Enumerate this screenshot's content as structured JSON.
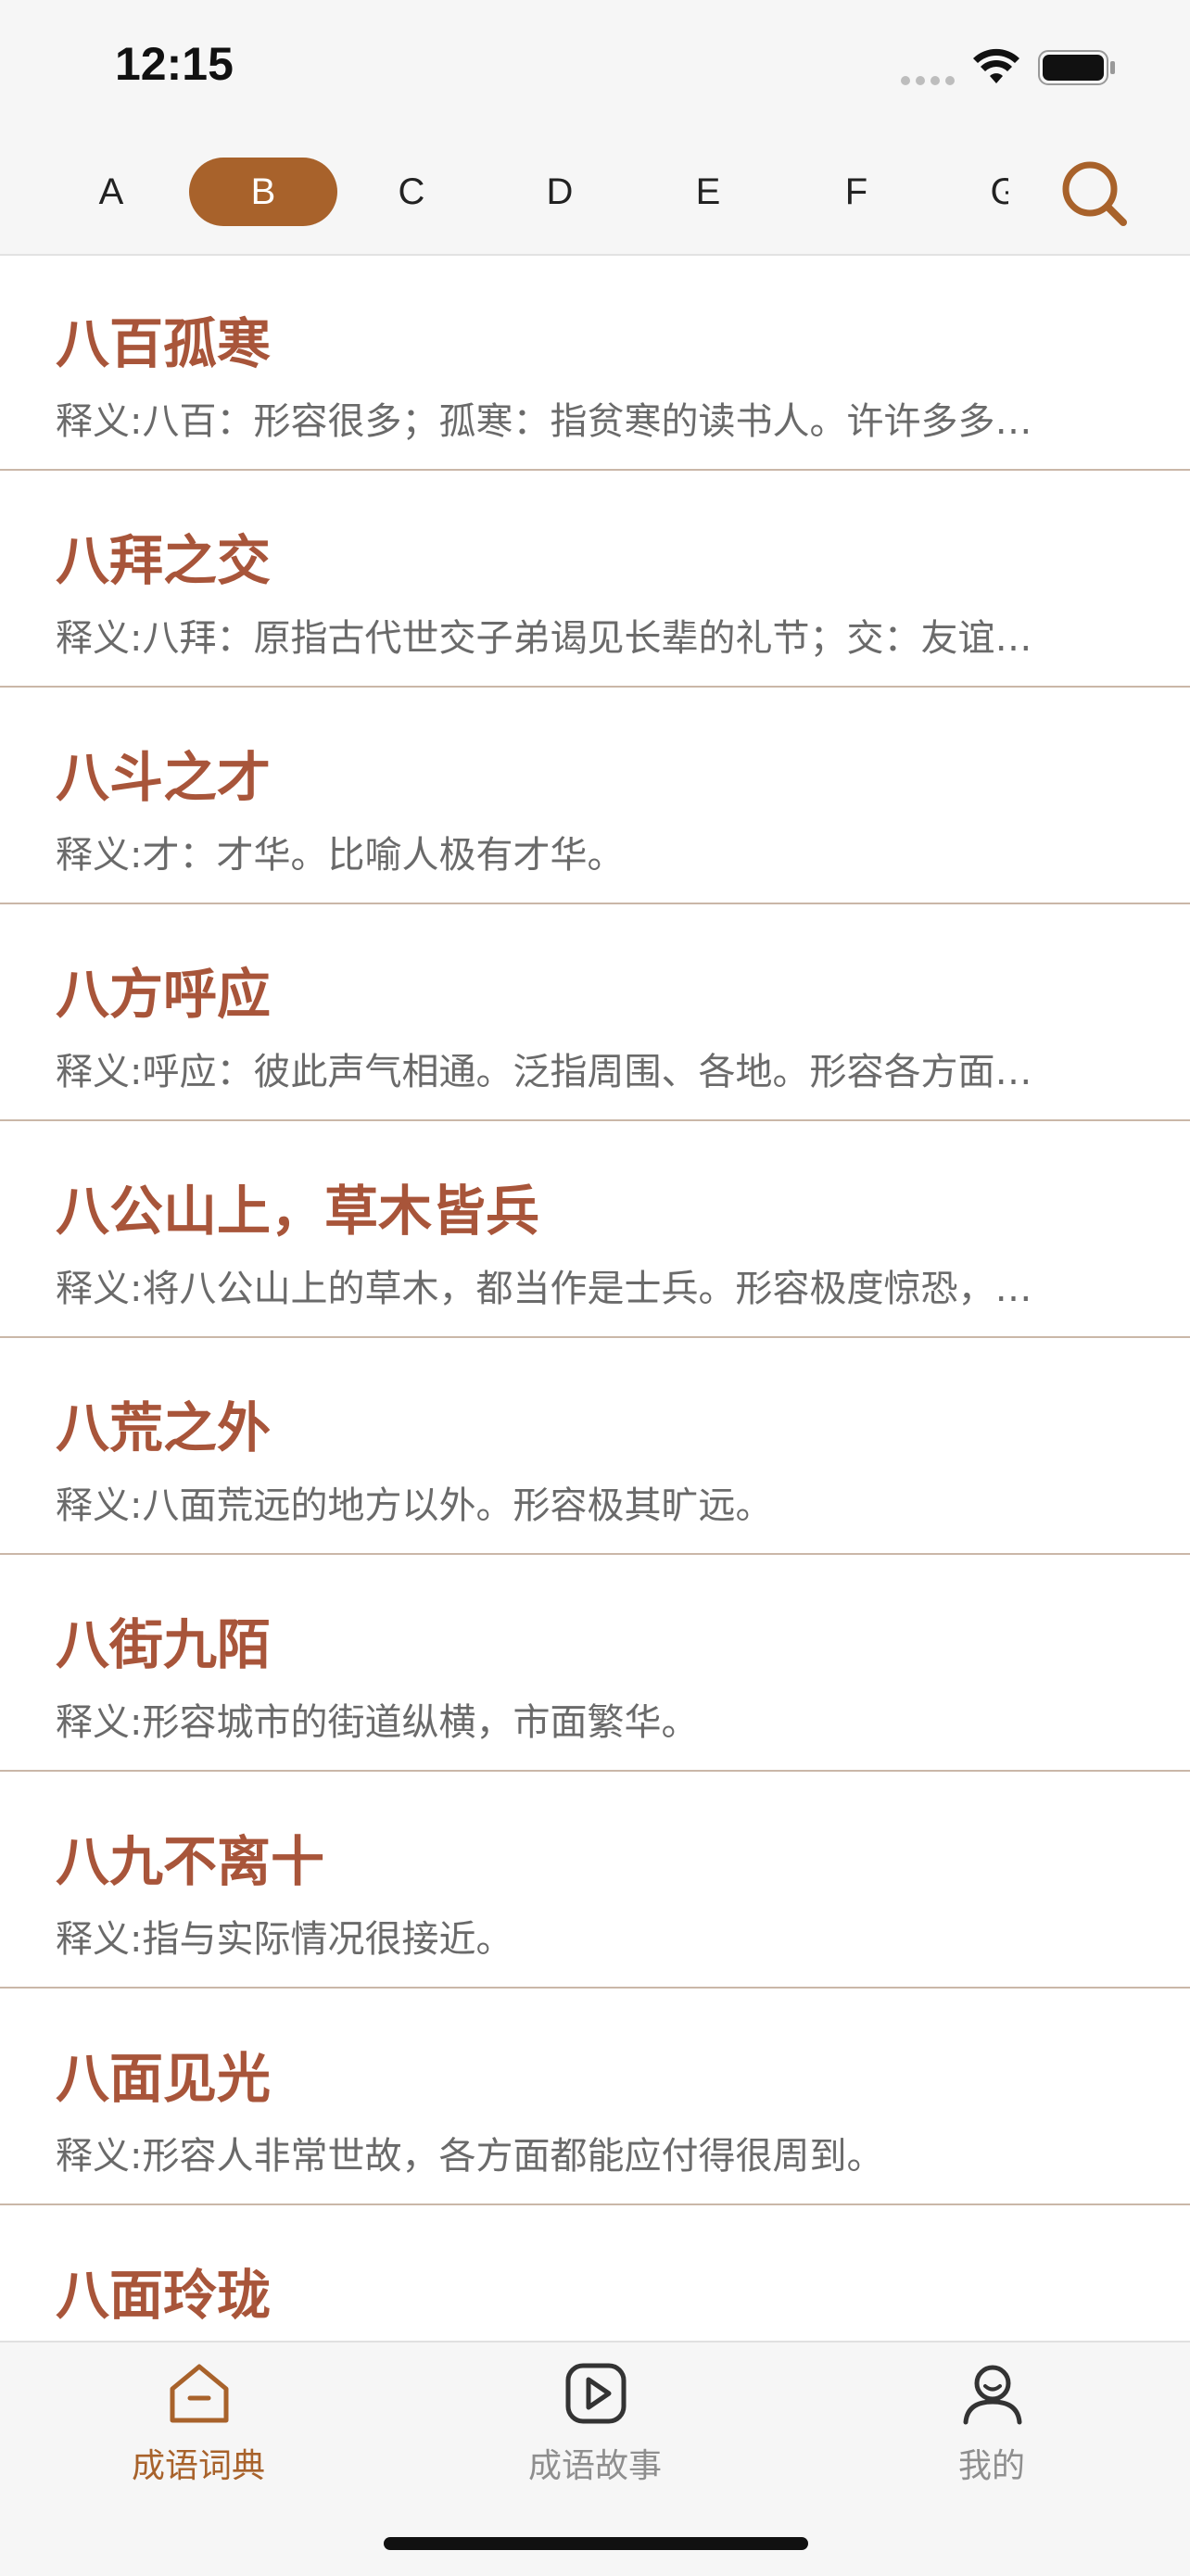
{
  "status_bar": {
    "time": "12:15"
  },
  "alphabet": {
    "letters": [
      "A",
      "B",
      "C",
      "D",
      "E",
      "F",
      "G"
    ],
    "active": "B"
  },
  "entries": [
    {
      "idiom": "八百孤寒",
      "desc": "释义:八百：形容很多；孤寒：指贫寒的读书人。许许多多…"
    },
    {
      "idiom": "八拜之交",
      "desc": "释义:八拜：原指古代世交子弟谒见长辈的礼节；交：友谊…"
    },
    {
      "idiom": "八斗之才",
      "desc": "释义:才：才华。比喻人极有才华。"
    },
    {
      "idiom": "八方呼应",
      "desc": "释义:呼应：彼此声气相通。泛指周围、各地。形容各方面…"
    },
    {
      "idiom": "八公山上，草木皆兵",
      "desc": "释义:将八公山上的草木，都当作是士兵。形容极度惊恐，…"
    },
    {
      "idiom": "八荒之外",
      "desc": "释义:八面荒远的地方以外。形容极其旷远。"
    },
    {
      "idiom": "八街九陌",
      "desc": "释义:形容城市的街道纵横，市面繁华。"
    },
    {
      "idiom": "八九不离十",
      "desc": "释义:指与实际情况很接近。"
    },
    {
      "idiom": "八面见光",
      "desc": "释义:形容人非常世故，各方面都能应付得很周到。"
    },
    {
      "idiom": "八面玲珑",
      "desc": ""
    }
  ],
  "tabs": [
    {
      "label": "成语词典",
      "icon": "home-icon",
      "active": true
    },
    {
      "label": "成语故事",
      "icon": "play-icon",
      "active": false
    },
    {
      "label": "我的",
      "icon": "user-icon",
      "active": false
    }
  ],
  "colors": {
    "accent": "#a8622b",
    "idiom_text": "#a8553a",
    "divider": "#cab7a8"
  }
}
